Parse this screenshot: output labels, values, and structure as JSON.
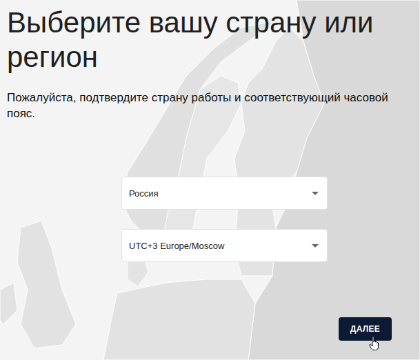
{
  "page": {
    "title": "Выберите вашу страну или регион",
    "subtitle": "Пожалуйста, подтвердите страну работы и соответствующий часовой пояс."
  },
  "fields": [
    {
      "name": "country",
      "value": "Россия"
    },
    {
      "name": "timezone",
      "value": "UTC+3 Europe/Moscow"
    }
  ],
  "buttons": [
    "ДАЛЕЕ"
  ]
}
